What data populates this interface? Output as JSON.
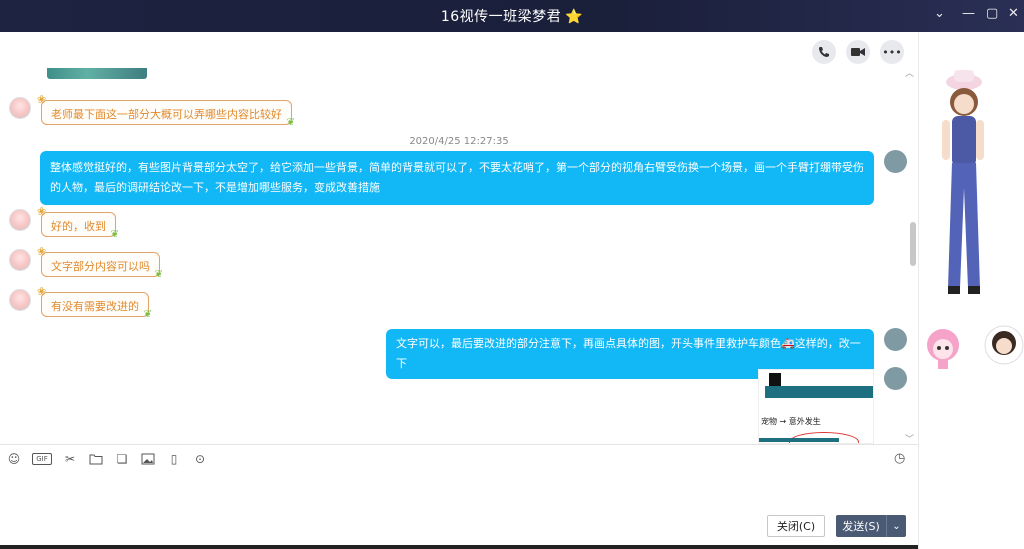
{
  "window": {
    "title": "16视传一班梁梦君",
    "title_badge": "⭐"
  },
  "header_actions": [
    {
      "name": "phone-call-button",
      "icon": "phone-icon"
    },
    {
      "name": "video-call-button",
      "icon": "video-icon"
    },
    {
      "name": "more-button",
      "icon": "more-icon"
    }
  ],
  "messages": {
    "m1": "老师最下面这一部分大概可以弄哪些内容比较好",
    "timestamp": "2020/4/25 12:27:35",
    "m2": "整体感觉挺好的，有些图片背景部分太空了，给它添加一些背景，简单的背景就可以了，不要太花哨了，第一个部分的视角右臂受伤换一个场景，画一个手臂打绷带受伤的人物，最后的调研结论改一下，不是增加哪些服务，变成改善措施",
    "m3": "好的，收到",
    "m4": "文字部分内容可以吗",
    "m5": "有没有需要改进的",
    "m6_before": "文字可以，最后要改进的部分注意下，再画点具体的图，开头事件里救护车颜色",
    "m6_emoji": "🚑",
    "m6_after": "这样的，改一下",
    "attachment_text": "宠物  → 意外发生"
  },
  "input_toolbar": {
    "gif_label": "GIF"
  },
  "buttons": {
    "close": "关闭(C)",
    "send": "发送(S)"
  },
  "colors": {
    "incoming_border": "#e0a46a",
    "incoming_text": "#e08a2c",
    "outgoing_bg": "#12b7f5",
    "send_button": "#4a5a74"
  }
}
